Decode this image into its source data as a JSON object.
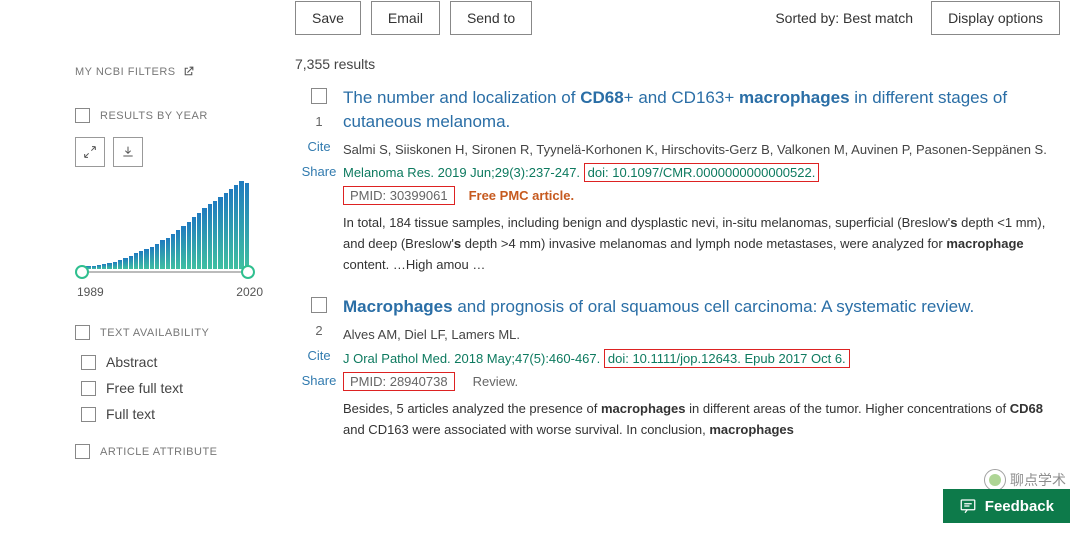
{
  "toolbar": {
    "save": "Save",
    "email": "Email",
    "send": "Send to",
    "sort_label": "Sorted by: Best match",
    "display": "Display options"
  },
  "results_count": "7,355 results",
  "sidebar": {
    "ncbi_filters": "MY NCBI FILTERS",
    "results_by_year": "RESULTS BY YEAR",
    "year_start": "1989",
    "year_end": "2020",
    "text_avail": "TEXT AVAILABILITY",
    "avail_items": [
      "Abstract",
      "Free full text",
      "Full text"
    ],
    "article_attr": "ARTICLE ATTRIBUTE"
  },
  "side_actions": {
    "cite": "Cite",
    "share": "Share"
  },
  "chart_data": {
    "type": "bar",
    "x_range": [
      1989,
      2020
    ],
    "values": [
      2,
      3,
      3,
      4,
      5,
      6,
      7,
      9,
      11,
      13,
      16,
      18,
      20,
      23,
      26,
      30,
      32,
      36,
      40,
      44,
      48,
      53,
      57,
      62,
      67,
      70,
      74,
      78,
      82,
      86,
      90,
      88
    ],
    "xlabel": "",
    "ylabel": "",
    "title": ""
  },
  "results": [
    {
      "index": "1",
      "title_html": "The number and localization of <b>CD68</b>+ and CD163+ <b>macrophages</b> in different stages of cutaneous melanoma.",
      "authors": "Salmi S, Siiskonen H, Sironen R, Tyynelä-Korhonen K, Hirschovits-Gerz B, Valkonen M, Auvinen P, Pasonen-Seppänen S.",
      "journal": "Melanoma Res. 2019 Jun;29(3):237-247.",
      "doi": "doi: 10.1097/CMR.0000000000000522.",
      "pmid": "PMID: 30399061",
      "tag": "Free PMC article.",
      "tag_class": "free",
      "snippet_html": "In total, 184 tissue samples, including benign and dysplastic nevi, in-situ melanomas, superficial (Breslow'<b>s</b> depth <1 mm), and deep (Breslow'<b>s</b> depth >4 mm) invasive melanomas and lymph node metastases, were analyzed for <b>macrophage</b> content. …High amou …"
    },
    {
      "index": "2",
      "title_html": "<b>Macrophages</b> and prognosis of oral squamous cell carcinoma: A systematic review.",
      "authors": "Alves AM, Diel LF, Lamers ML.",
      "journal": "J Oral Pathol Med. 2018 May;47(5):460-467.",
      "doi": "doi: 10.1111/jop.12643. Epub 2017 Oct 6.",
      "pmid": "PMID: 28940738",
      "tag": "Review.",
      "tag_class": "review",
      "snippet_html": "Besides, 5 articles analyzed the presence of <b>macrophages</b> in different areas of the tumor. Higher concentrations of <b>CD68</b> and CD163 were associated with worse survival. In conclusion, <b>macrophages</b>"
    }
  ],
  "feedback_label": "Feedback",
  "watermark": "聊点学术"
}
